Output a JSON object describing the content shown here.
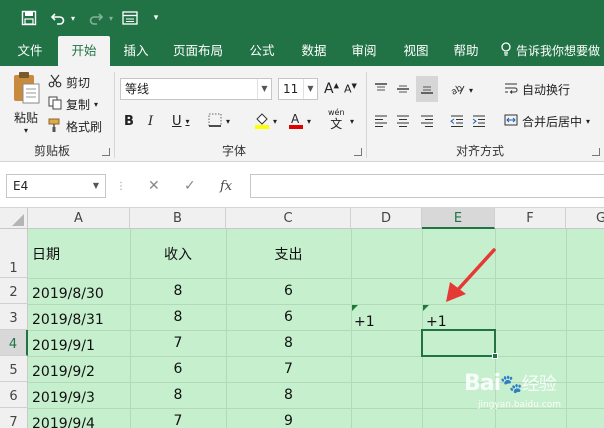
{
  "qat": {
    "save_icon": "save-icon",
    "undo_icon": "undo-icon",
    "redo_icon": "redo-icon",
    "form_icon": "form-icon",
    "customize_icon": "customize-qat-icon"
  },
  "tabs": [
    {
      "label": "文件"
    },
    {
      "label": "开始"
    },
    {
      "label": "插入"
    },
    {
      "label": "页面布局"
    },
    {
      "label": "公式"
    },
    {
      "label": "数据"
    },
    {
      "label": "审阅"
    },
    {
      "label": "视图"
    },
    {
      "label": "帮助"
    }
  ],
  "tell_me": "告诉我你想要做",
  "clipboard": {
    "paste": "粘贴",
    "cut": "剪切",
    "copy": "复制",
    "format_painter": "格式刷",
    "group": "剪贴板"
  },
  "font": {
    "name": "等线",
    "size": "11",
    "bold": "B",
    "italic": "I",
    "underline": "U",
    "group": "字体",
    "wen": "wén"
  },
  "alignment": {
    "wrap": "自动换行",
    "merge": "合并后居中",
    "group": "对齐方式"
  },
  "formula_bar": {
    "name_box": "E4",
    "fx": "fx",
    "value": ""
  },
  "sheet": {
    "columns": [
      "A",
      "B",
      "C",
      "D",
      "E",
      "F",
      "G"
    ],
    "rows": [
      "1",
      "2",
      "3",
      "4",
      "5",
      "6",
      "7"
    ],
    "header": {
      "a": "日期",
      "b": "收入",
      "c": "支出"
    },
    "data": [
      {
        "a": "2019/8/30",
        "b": "8",
        "c": "6"
      },
      {
        "a": "2019/8/31",
        "b": "8",
        "c": "6"
      },
      {
        "a": "2019/9/1",
        "b": "7",
        "c": "8"
      },
      {
        "a": "2019/9/2",
        "b": "6",
        "c": "7"
      },
      {
        "a": "2019/9/3",
        "b": "8",
        "c": "8"
      },
      {
        "a": "2019/9/4",
        "b": "7",
        "c": "9"
      }
    ],
    "d3": "+1",
    "e3": "+1"
  },
  "colors": {
    "brand": "#217346",
    "sheet_fill": "#c6efce",
    "arrow": "#e53935"
  },
  "watermark": {
    "brand": "Bai",
    "brand2": "经验",
    "url": "jingyan.baidu.com"
  }
}
